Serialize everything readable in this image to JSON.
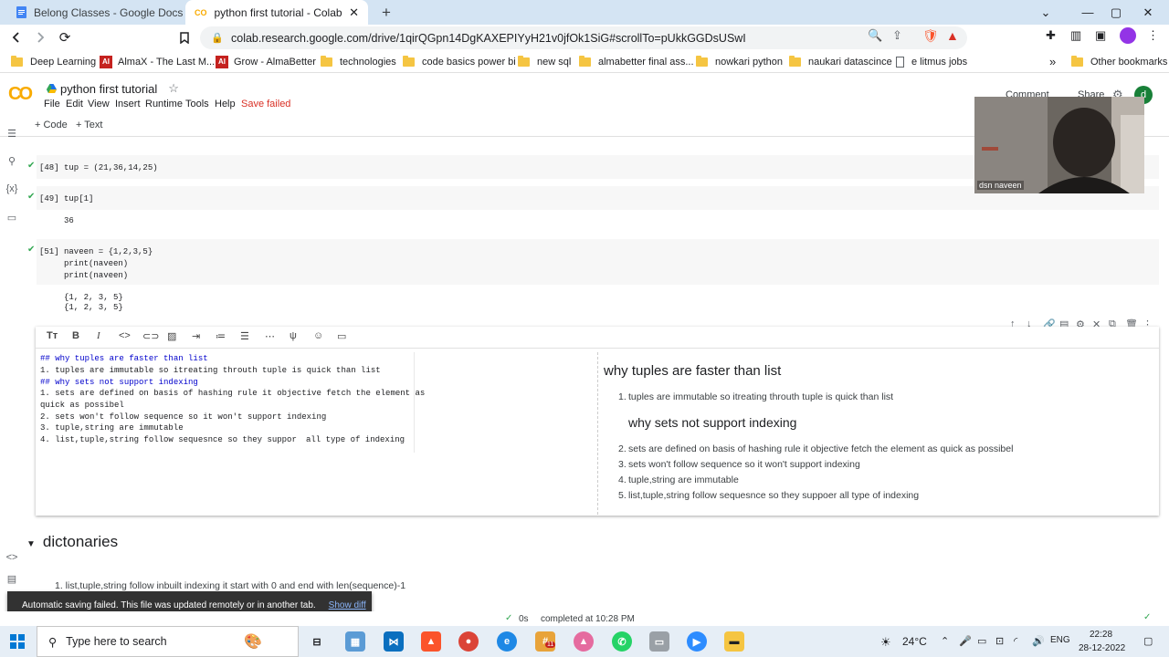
{
  "browser": {
    "tabs": [
      {
        "title": "Belong Classes - Google Docs",
        "icon": "google-docs-icon"
      },
      {
        "title": "python first tutorial - Colaborator",
        "icon": "colab-icon"
      }
    ],
    "new_tab": "+",
    "url": "colab.research.google.com/drive/1qirQGpn14DgKAXEPIYyH21v0jfOk1SiG#scrollTo=pUkkGGDsUSwI",
    "bookmarks": [
      {
        "label": "Deep Learning",
        "type": "folder"
      },
      {
        "label": "AlmaX - The Last M...",
        "type": "site"
      },
      {
        "label": "Grow - AlmaBetter",
        "type": "site"
      },
      {
        "label": "technologies",
        "type": "folder"
      },
      {
        "label": "code basics power bi",
        "type": "folder"
      },
      {
        "label": "new sql",
        "type": "folder"
      },
      {
        "label": "almabetter final ass...",
        "type": "folder"
      },
      {
        "label": "nowkari python",
        "type": "folder"
      },
      {
        "label": "naukari datascince",
        "type": "folder"
      },
      {
        "label": "e litmus jobs",
        "type": "file"
      }
    ],
    "more_bookmarks": "»",
    "other_bookmarks": "Other bookmarks",
    "profile_letter": "d"
  },
  "colab": {
    "logo": "CO",
    "title": "python first tutorial",
    "menu": [
      "File",
      "Edit",
      "View",
      "Insert",
      "Runtime",
      "Tools",
      "Help"
    ],
    "save_status": "Save failed",
    "add_code": "+ Code",
    "add_text": "+ Text",
    "comment": "Comment",
    "share": "Share",
    "user_letter": "d"
  },
  "cells": [
    {
      "prompt": "[48]",
      "code": "tup = (21,36,14,25)",
      "output": ""
    },
    {
      "prompt": "[49]",
      "code": "tup[1]",
      "output": "36"
    },
    {
      "prompt": "[51]",
      "code_lines": [
        "naveen = {1,2,3,5}",
        "print(naveen)",
        "print(naveen)"
      ],
      "output_lines": [
        "{1, 2, 3, 5}",
        "{1, 2, 3, 5}"
      ]
    }
  ],
  "editor": {
    "source_lines": [
      "## why tuples are faster than list",
      "1. tuples are immutable so itreating throuth tuple is quick than list",
      "## why sets not support indexing",
      "1. sets are defined on basis of hashing rule it objective fetch the element as",
      "quick as possibel",
      "2. sets won't follow sequence so it won't support indexing",
      "3. tuple,string are immutable",
      "4. list,tuple,string follow sequesnce so they suppor",
      "all type of indexing"
    ],
    "rendered": {
      "h1": "why tuples are faster than list",
      "items1": [
        "tuples are immutable so itreating throuth tuple is quick than list"
      ],
      "h2": "why sets not support indexing",
      "items2": [
        "sets are defined on basis of hashing rule it objective fetch the element as quick as possibel",
        "sets won't follow sequence so it won't support indexing",
        "tuple,string are immutable",
        "list,tuple,string follow sequesnce so they suppoer all type of indexing"
      ],
      "nums1": [
        "1."
      ],
      "nums2": [
        "2.",
        "3.",
        "4.",
        "5."
      ]
    }
  },
  "section": {
    "title": "dictonaries",
    "first_item": "1. list,tuple,string follow inbuilt indexing it start with 0 and end with len(sequence)-1"
  },
  "snackbar": {
    "message": "Automatic saving failed. This file was updated remotely or in another tab.",
    "action": "Show diff"
  },
  "status": {
    "time": "0s",
    "completed": "completed at 10:28 PM"
  },
  "webcam": {
    "name": "dsn naveen"
  },
  "taskbar": {
    "search_placeholder": "Type here to search",
    "weather": "24°C",
    "lang": "ENG",
    "time": "22:28",
    "date": "28-12-2022",
    "badge": "11"
  },
  "colors": {
    "accent": "#f9ab00",
    "error": "#d93025",
    "link": "#1a73e8",
    "tab_strip": "#d4e4f3"
  }
}
